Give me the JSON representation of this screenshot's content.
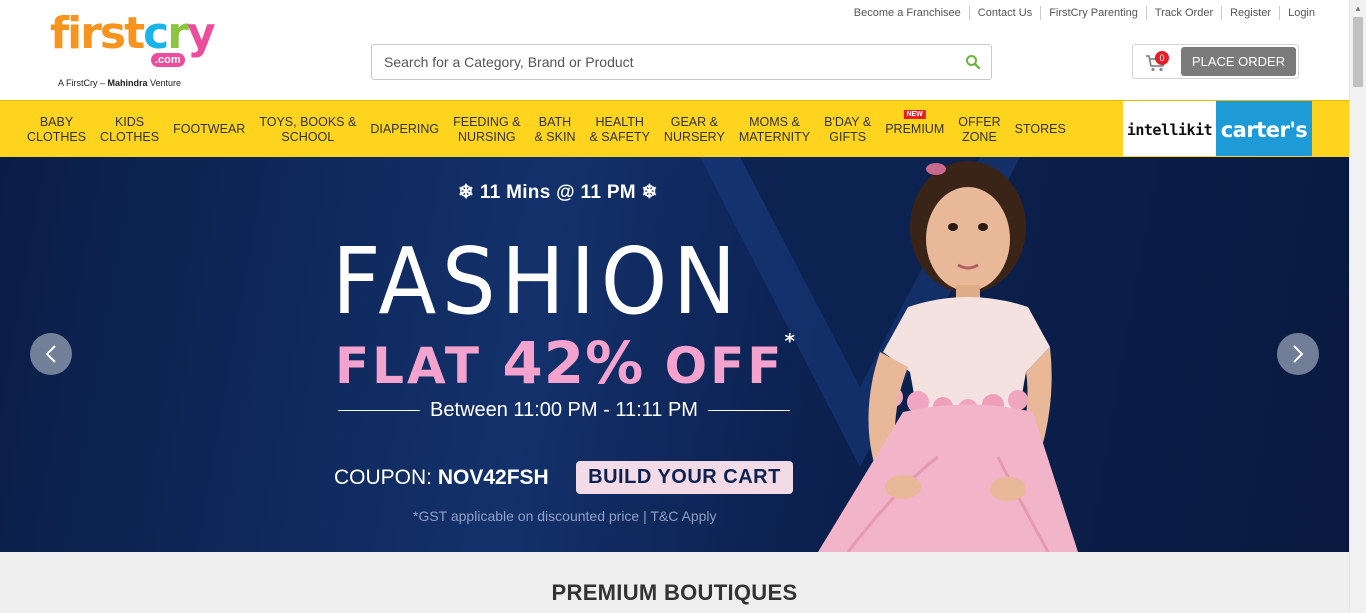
{
  "header": {
    "logo": {
      "word_parts": [
        "first",
        "c",
        "r",
        "y"
      ],
      "domain": ".com",
      "tagline_prefix": "A FirstCry – ",
      "tagline_brand": "Mahindra",
      "tagline_suffix": " Venture"
    },
    "toplinks": [
      "Become a Franchisee",
      "Contact Us",
      "FirstCry Parenting",
      "Track Order",
      "Register",
      "Login"
    ],
    "search": {
      "placeholder": "Search for a Category, Brand or Product",
      "value": ""
    },
    "cart": {
      "count": "0",
      "place_order_label": "PLACE ORDER"
    }
  },
  "nav": {
    "items": [
      {
        "line1": "BABY",
        "line2": "CLOTHES"
      },
      {
        "line1": "KIDS",
        "line2": "CLOTHES"
      },
      {
        "line1": "FOOTWEAR",
        "line2": ""
      },
      {
        "line1": "TOYS, BOOKS &",
        "line2": "SCHOOL"
      },
      {
        "line1": "DIAPERING",
        "line2": ""
      },
      {
        "line1": "FEEDING &",
        "line2": "NURSING"
      },
      {
        "line1": "BATH",
        "line2": "& SKIN"
      },
      {
        "line1": "HEALTH",
        "line2": "& SAFETY"
      },
      {
        "line1": "GEAR &",
        "line2": "NURSERY"
      },
      {
        "line1": "MOMS &",
        "line2": "MATERNITY"
      },
      {
        "line1": "B'DAY &",
        "line2": "GIFTS"
      },
      {
        "line1": "PREMIUM",
        "line2": "",
        "badge": "NEW"
      },
      {
        "line1": "OFFER",
        "line2": "ZONE"
      },
      {
        "line1": "STORES",
        "line2": ""
      }
    ],
    "brand_intellikit": "intellikit",
    "brand_carters": "carter's"
  },
  "banner": {
    "top_text": "11 Mins @ 11 PM",
    "headline": "FASHION",
    "offer_prefix": "FLAT",
    "offer_pct": "42%",
    "offer_suffix": "OFF",
    "offer_star": "*",
    "between": "Between 11:00 PM - 11:11 PM",
    "coupon_label": "COUPON:",
    "coupon_code": "NOV42FSH",
    "cta": "BUILD YOUR CART",
    "gst_note": "*GST applicable on discounted price | T&C Apply"
  },
  "section": {
    "title": "PREMIUM BOUTIQUES"
  },
  "colors": {
    "nav_bg": "#ffd41f",
    "banner_bg": "#0b1f4a",
    "offer_pink": "#f4a3cf",
    "carters_blue": "#1e9ad6",
    "place_order_bg": "#7b7b7b"
  }
}
